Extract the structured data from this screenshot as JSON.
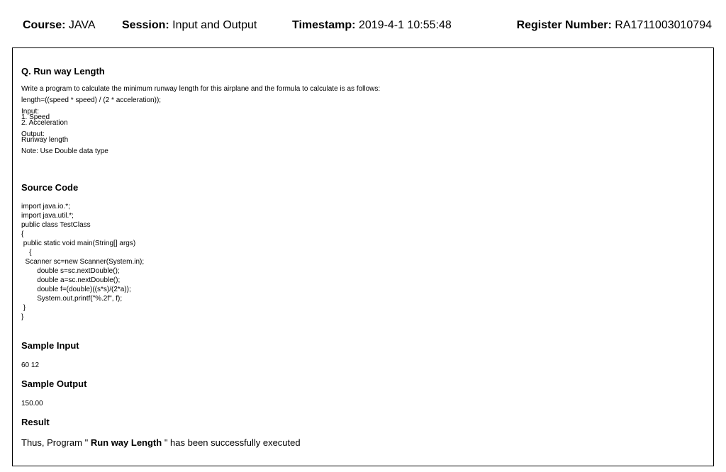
{
  "header": {
    "course_label": "Course:",
    "course_value": "JAVA",
    "session_label": "Session:",
    "session_value": "Input and Output",
    "timestamp_label": "Timestamp:",
    "timestamp_value": "2019-4-1 10:55:48",
    "register_label": "Register Number:",
    "register_value": "RA1711003010794"
  },
  "question": {
    "title": "Q. Run way Length",
    "description": "Write a program to calculate the minimum runway length for this airplane and the formula to calculate is as follows:",
    "formula": "length=((speed * speed) / (2 * acceleration));",
    "input_label": "Input:",
    "input_item_1": "1. Speed",
    "input_item_2": "2. Acceleration",
    "output_label": "Output:",
    "output_item": "Runway length",
    "note": "Note: Use Double data type"
  },
  "source_code": {
    "title": "Source Code",
    "lines": [
      "import java.io.*;",
      "import java.util.*;",
      "public class TestClass",
      "{",
      " public static void main(String[] args)",
      "    {",
      "  Scanner sc=new Scanner(System.in);",
      "        double s=sc.nextDouble();",
      "        double a=sc.nextDouble();",
      "        double f=(double)((s*s)/(2*a));",
      "        System.out.printf(\"%.2f\", f);",
      " }",
      "}"
    ]
  },
  "sample_input": {
    "title": "Sample Input",
    "value": "60 12"
  },
  "sample_output": {
    "title": "Sample Output",
    "value": "150.00"
  },
  "result": {
    "title": "Result",
    "prefix": "Thus, Program \" ",
    "program_name": "Run way Length",
    "suffix": " \" has been successfully executed"
  }
}
